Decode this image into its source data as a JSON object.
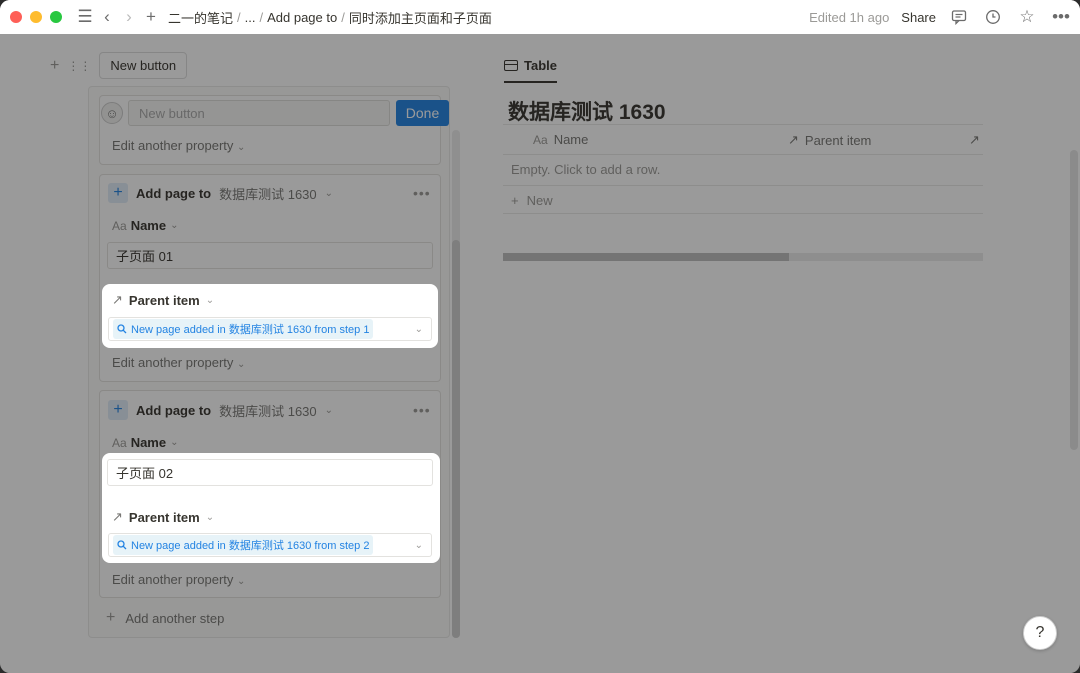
{
  "topbar": {
    "breadcrumbs": [
      "二一的笔记",
      "...",
      "Add page to",
      "同时添加主页面和子页面"
    ],
    "edited": "Edited 1h ago",
    "share": "Share"
  },
  "builder": {
    "button_chip": "New button",
    "name_placeholder": "New button",
    "done": "Done",
    "edit_another": "Edit another property",
    "steps": [
      {
        "title": "Add page to",
        "database": "数据库测试 1630",
        "name_label": "Name",
        "name_value": "子页面 01",
        "parent_label": "Parent item",
        "parent_value": "New page added in 数据库测试 1630 from step 1",
        "edit_another": "Edit another property"
      },
      {
        "title": "Add page to",
        "database": "数据库测试 1630",
        "name_label": "Name",
        "name_value": "子页面 02",
        "parent_label": "Parent item",
        "parent_value": "New page added in 数据库测试 1630 from step 2",
        "edit_another": "Edit another property"
      }
    ],
    "add_step": "Add another step"
  },
  "table": {
    "tab": "Table",
    "title": "数据库测试 1630",
    "columns": [
      "Name",
      "Parent item"
    ],
    "empty": "Empty. Click to add a row.",
    "new": "New"
  },
  "icons": {
    "aa": "Aa"
  }
}
